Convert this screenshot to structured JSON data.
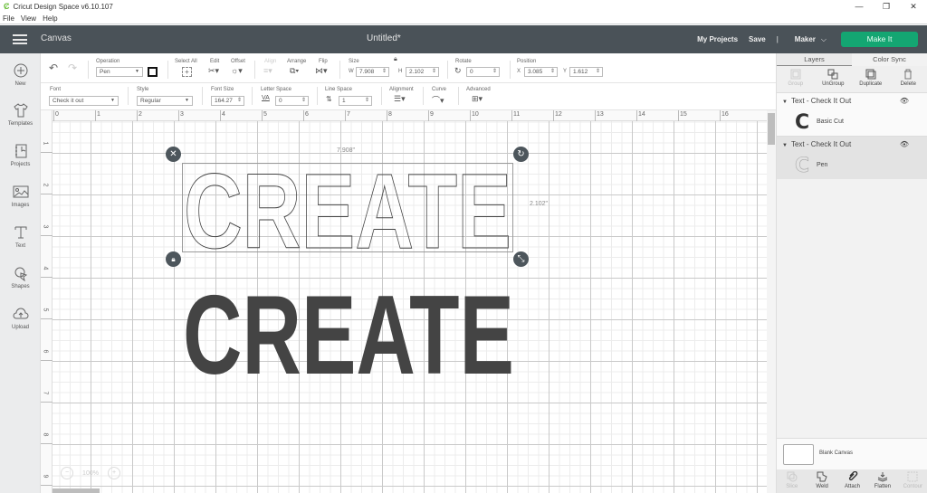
{
  "titlebar": {
    "app_title": "Cricut Design Space  v6.10.107",
    "minimize": "—",
    "restore": "❐",
    "close": "✕"
  },
  "menubar": {
    "items": [
      "File",
      "View",
      "Help"
    ]
  },
  "header": {
    "section": "Canvas",
    "doc_title": "Untitled*",
    "my_projects": "My Projects",
    "save": "Save",
    "divider": "|",
    "machine": "Maker",
    "machine_chevron": "⌵",
    "make_it": "Make It"
  },
  "sidebar": {
    "items": [
      {
        "label": "New",
        "icon": "plus-circle-icon"
      },
      {
        "label": "Templates",
        "icon": "tshirt-icon"
      },
      {
        "label": "Projects",
        "icon": "notebook-icon"
      },
      {
        "label": "Images",
        "icon": "image-icon"
      },
      {
        "label": "Text",
        "icon": "text-icon"
      },
      {
        "label": "Shapes",
        "icon": "shapes-icon"
      },
      {
        "label": "Upload",
        "icon": "cloud-upload-icon"
      }
    ]
  },
  "toolbar": {
    "operation_label": "Operation",
    "operation_value": "Pen",
    "select_all": "Select All",
    "edit": "Edit",
    "offset": "Offset",
    "align": "Align",
    "arrange": "Arrange",
    "flip": "Flip",
    "size_label": "Size",
    "w_label": "W",
    "w_value": "7.908",
    "h_label": "H",
    "h_value": "2.102",
    "rotate_label": "Rotate",
    "rotate_value": "0",
    "position_label": "Position",
    "x_label": "X",
    "x_value": "3.085",
    "y_label": "Y",
    "y_value": "1.612"
  },
  "text_toolbar": {
    "font_label": "Font",
    "font_value": "Check it out",
    "style_label": "Style",
    "style_value": "Regular",
    "font_size_label": "Font Size",
    "font_size_value": "164.27",
    "letter_space_label": "Letter Space",
    "letter_space_value": "0",
    "line_space_label": "Line Space",
    "line_space_value": "1",
    "alignment_label": "Alignment",
    "curve_label": "Curve",
    "advanced_label": "Advanced"
  },
  "canvas": {
    "ruler_top": [
      "0",
      "1",
      "2",
      "3",
      "4",
      "5",
      "6",
      "7",
      "8",
      "9",
      "10",
      "11",
      "12",
      "13",
      "14",
      "15",
      "16"
    ],
    "ruler_left": [
      "1",
      "2",
      "3",
      "4",
      "5",
      "6",
      "7",
      "8",
      "9"
    ],
    "width_label": "7.908\"",
    "height_label": "2.102\"",
    "outline_text": "CREATE",
    "solid_text": "CREATE",
    "zoom_level": "100%",
    "zoom_out": "−",
    "zoom_in": "+"
  },
  "layers_panel": {
    "tabs": [
      "Layers",
      "Color Sync"
    ],
    "actions": [
      "Group",
      "UnGroup",
      "Duplicate",
      "Delete"
    ],
    "layers": [
      {
        "name": "Text - Check It Out",
        "glyph": "C",
        "operation": "Basic Cut"
      },
      {
        "name": "Text - Check It Out",
        "glyph": "C",
        "operation": "Pen"
      }
    ],
    "blank_canvas": "Blank Canvas",
    "bottom_actions": [
      "Slice",
      "Weld",
      "Attach",
      "Flatten",
      "Contour"
    ]
  }
}
